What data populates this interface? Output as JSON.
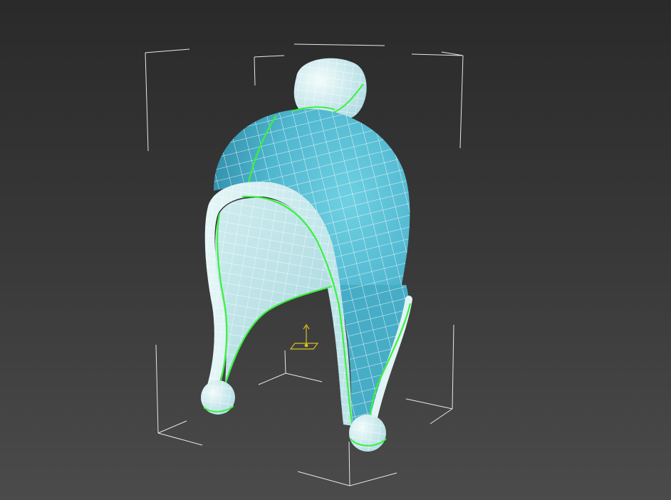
{
  "viewport": {
    "type": "3d-perspective-viewport",
    "content": "hat-mesh",
    "selection_state": "selected",
    "background_color_top": "#2a2a2a",
    "background_color_bottom": "#4b4b4b"
  },
  "colors": {
    "mesh_fill_dark": "#3fa3bd",
    "mesh_fill_mid": "#5cc2d8",
    "mesh_fill_light": "#d9f0f2",
    "wireframe": "#ffffff",
    "seam_edges": "#39f23c",
    "bounding_box": "#e8e8e8",
    "pivot_gizmo": "#d6c020"
  },
  "icons": [
    "pivot-gizmo-icon"
  ]
}
